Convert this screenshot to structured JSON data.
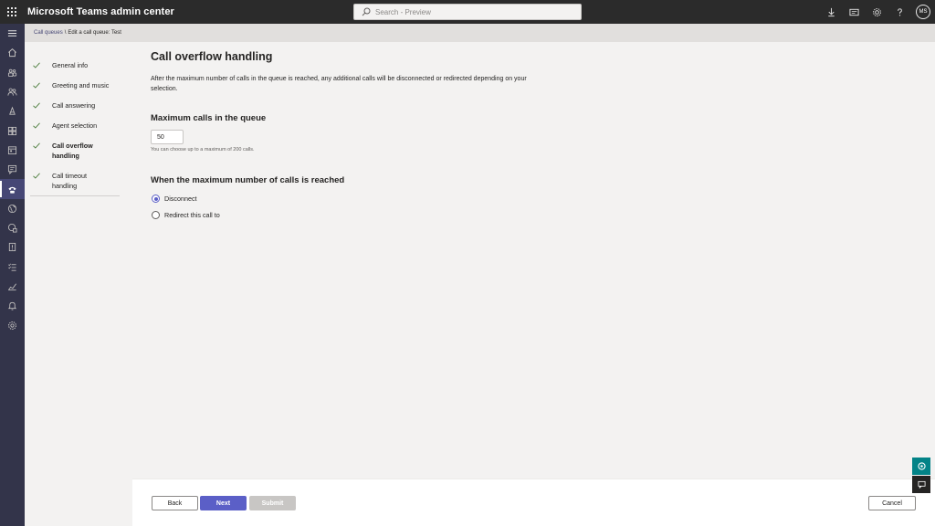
{
  "topbar": {
    "app_title": "Microsoft Teams admin center",
    "search_placeholder": "Search - Preview",
    "icons": [
      "download-icon",
      "cards-icon",
      "gear-icon",
      "help-icon"
    ],
    "avatar_initials": "MS"
  },
  "rail": {
    "icons": [
      "menu-icon",
      "home-icon",
      "teams-icon",
      "users-icon",
      "devices-icon",
      "apps-icon",
      "meetings-icon",
      "messaging-icon",
      "voice-icon",
      "locations-icon",
      "policy-icon",
      "planning-icon",
      "analytics-icon",
      "reports-icon",
      "notifications-icon",
      "settings-icon"
    ],
    "active_index": 8
  },
  "breadcrumb": {
    "parent": "Call queues",
    "separator": "\\",
    "current": "Edit a call queue: Test"
  },
  "steps": [
    {
      "label": "General info",
      "done": true
    },
    {
      "label": "Greeting and music",
      "done": true
    },
    {
      "label": "Call answering",
      "done": true
    },
    {
      "label": "Agent selection",
      "done": true
    },
    {
      "label": "Call overflow handling",
      "done": true,
      "current": true
    },
    {
      "label": "Call timeout handling",
      "done": true
    }
  ],
  "main": {
    "title": "Call overflow handling",
    "description": "After the maximum number of calls in the queue is reached, any additional calls will be disconnected or redirected depending on your selection.",
    "max_calls": {
      "heading": "Maximum calls in the queue",
      "value": "50",
      "help": "You can choose up to a maximum of 200 calls."
    },
    "when_reached": {
      "heading": "When the maximum number of calls is reached",
      "options": [
        {
          "label": "Disconnect",
          "checked": true
        },
        {
          "label": "Redirect this call to",
          "checked": false
        }
      ]
    }
  },
  "footer": {
    "back": "Back",
    "next": "Next",
    "submit": "Submit",
    "cancel": "Cancel"
  },
  "colors": {
    "accent": "#5b5fc7",
    "rail": "#33344a",
    "topbar": "#2b2b2b",
    "help_button": "#038387"
  }
}
